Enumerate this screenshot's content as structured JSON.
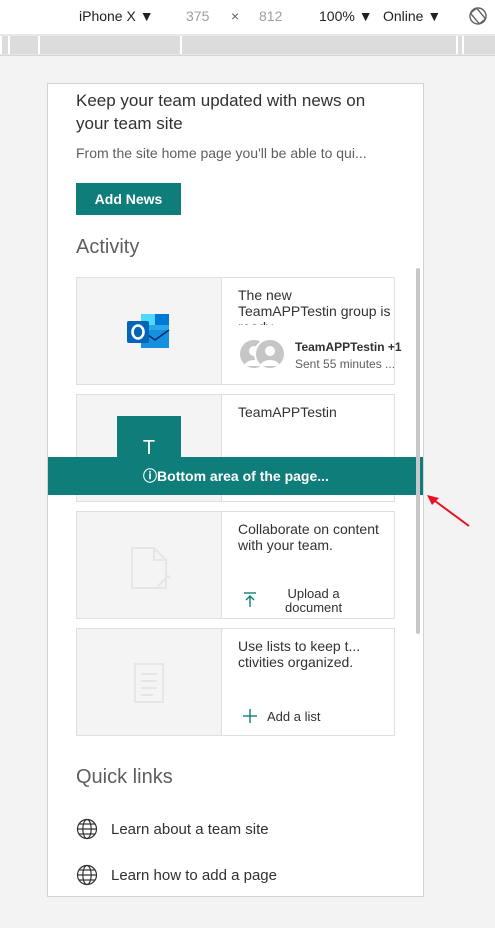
{
  "devtools": {
    "device": "iPhone X ▼",
    "width": "375",
    "times": "×",
    "height": "812",
    "zoom": "100% ▼",
    "network": "Online ▼",
    "rotate_icon": "rotate-icon"
  },
  "news": {
    "title": "Keep your team updated with news on your team site",
    "description": "From the site home page you'll be able to qui...",
    "add_button": "Add News"
  },
  "activity": {
    "title": "Activity",
    "cards": [
      {
        "text": "The new TeamAPPTestin group is ready",
        "author": "TeamAPPTestin +1",
        "time": "Sent 55 minutes ..."
      },
      {
        "text": "TeamAPPTestin",
        "tile_letter": "T"
      },
      {
        "text": "Collaborate on content with your team.",
        "action_line1": "Upload a",
        "action_line2": "document"
      },
      {
        "text": "Use lists to keep t... ctivities organized.",
        "action": "Add a list"
      }
    ]
  },
  "banner": {
    "icon": "ⓘ",
    "text": "Bottom area of the page..."
  },
  "quick_links": {
    "title": "Quick links",
    "items": [
      {
        "label": "Learn about a team site"
      },
      {
        "label": "Learn how to add a page"
      }
    ]
  },
  "colors": {
    "accent": "#0f7d7a",
    "outlook_blue": "#0364b8",
    "annotation_red": "#e81123"
  }
}
